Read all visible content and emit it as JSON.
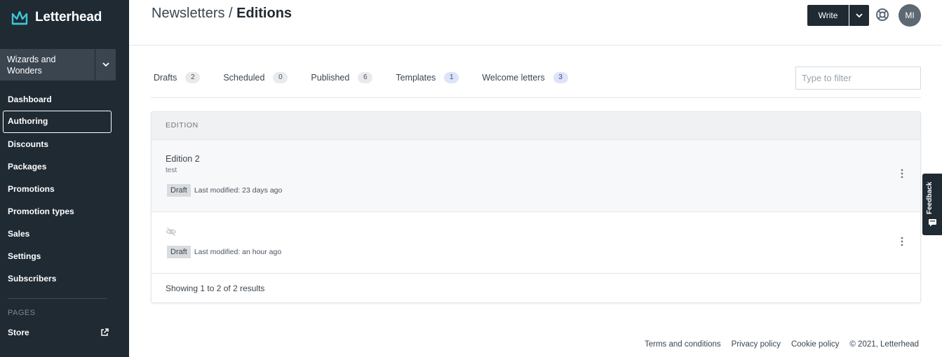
{
  "brand": {
    "name": "Letterhead",
    "accent": "#3ec4d6"
  },
  "sidebar": {
    "publication": "Wizards and Wonders",
    "items": [
      {
        "label": "Dashboard",
        "active": false
      },
      {
        "label": "Authoring",
        "active": true
      },
      {
        "label": "Discounts",
        "active": false
      },
      {
        "label": "Packages",
        "active": false
      },
      {
        "label": "Promotions",
        "active": false
      },
      {
        "label": "Promotion types",
        "active": false
      },
      {
        "label": "Sales",
        "active": false
      },
      {
        "label": "Settings",
        "active": false
      },
      {
        "label": "Subscribers",
        "active": false
      }
    ],
    "section_label": "PAGES",
    "store_label": "Store"
  },
  "header": {
    "breadcrumb_parent": "Newsletters /",
    "breadcrumb_current": "Editions",
    "write_label": "Write",
    "avatar_initials": "MI"
  },
  "tabs": [
    {
      "label": "Drafts",
      "count": "2",
      "highlight": false
    },
    {
      "label": "Scheduled",
      "count": "0",
      "highlight": false
    },
    {
      "label": "Published",
      "count": "6",
      "highlight": false
    },
    {
      "label": "Templates",
      "count": "1",
      "highlight": true
    },
    {
      "label": "Welcome letters",
      "count": "3",
      "highlight": true
    }
  ],
  "filter": {
    "placeholder": "Type to filter",
    "value": ""
  },
  "table": {
    "header": "EDITION",
    "rows": [
      {
        "title": "Edition 2",
        "subtitle": "test",
        "status": "Draft",
        "modified": "Last modified: 23 days ago"
      },
      {
        "title": "",
        "subtitle": "",
        "status": "Draft",
        "modified": "Last modified: an hour ago"
      }
    ],
    "footer": "Showing 1 to 2 of 2 results"
  },
  "feedback_label": "Feedback",
  "footer": {
    "links": [
      "Terms and conditions",
      "Privacy policy",
      "Cookie policy"
    ],
    "copyright": "© 2021, Letterhead"
  }
}
